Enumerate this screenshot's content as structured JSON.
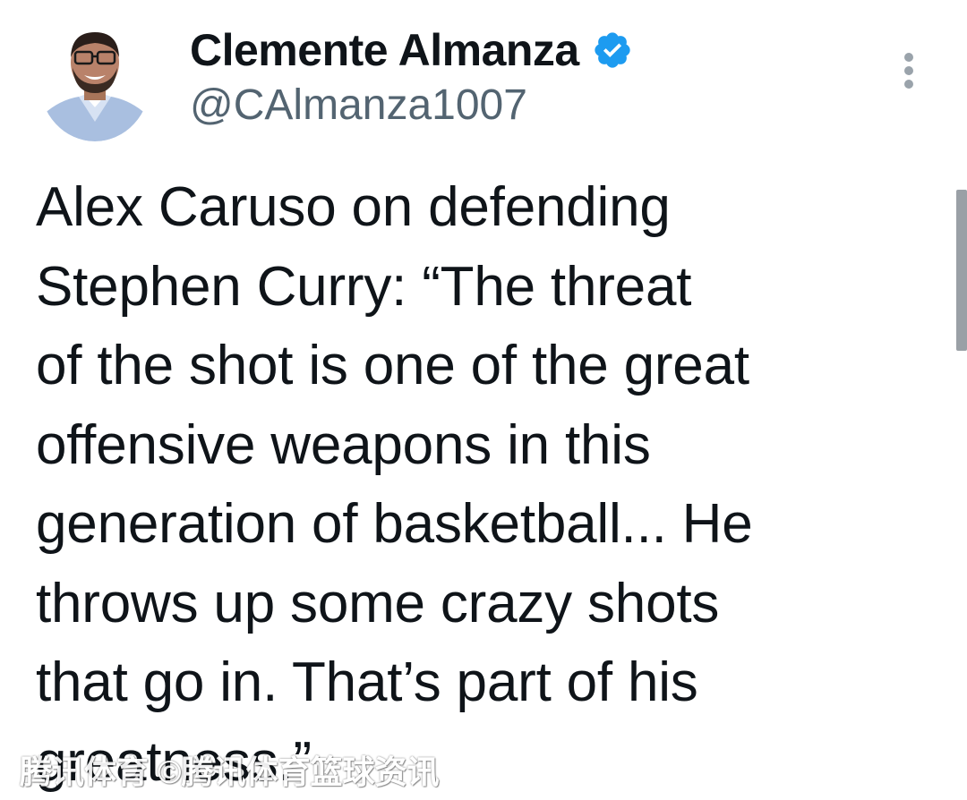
{
  "tweet": {
    "author": {
      "display_name": "Clemente Almanza",
      "handle": "@CAlmanza1007",
      "verified": true,
      "verified_badge_color": "#1d9bf0",
      "avatar_icon": "avatar-photo"
    },
    "text": "Alex Caruso on defending\nStephen Curry: “The threat\nof the shot is one of the great\noffensive weapons in this\ngeneration of basketball... He\nthrows up some crazy shots\nthat go in. That’s part of his\ngreatness.”",
    "more_icon": "vertical-ellipsis-icon"
  },
  "watermark": {
    "text": "腾讯体育 ©腾讯体育篮球资讯"
  },
  "colors": {
    "text_primary": "#0f1419",
    "text_secondary": "#536471",
    "accent": "#1d9bf0",
    "background": "#ffffff"
  }
}
